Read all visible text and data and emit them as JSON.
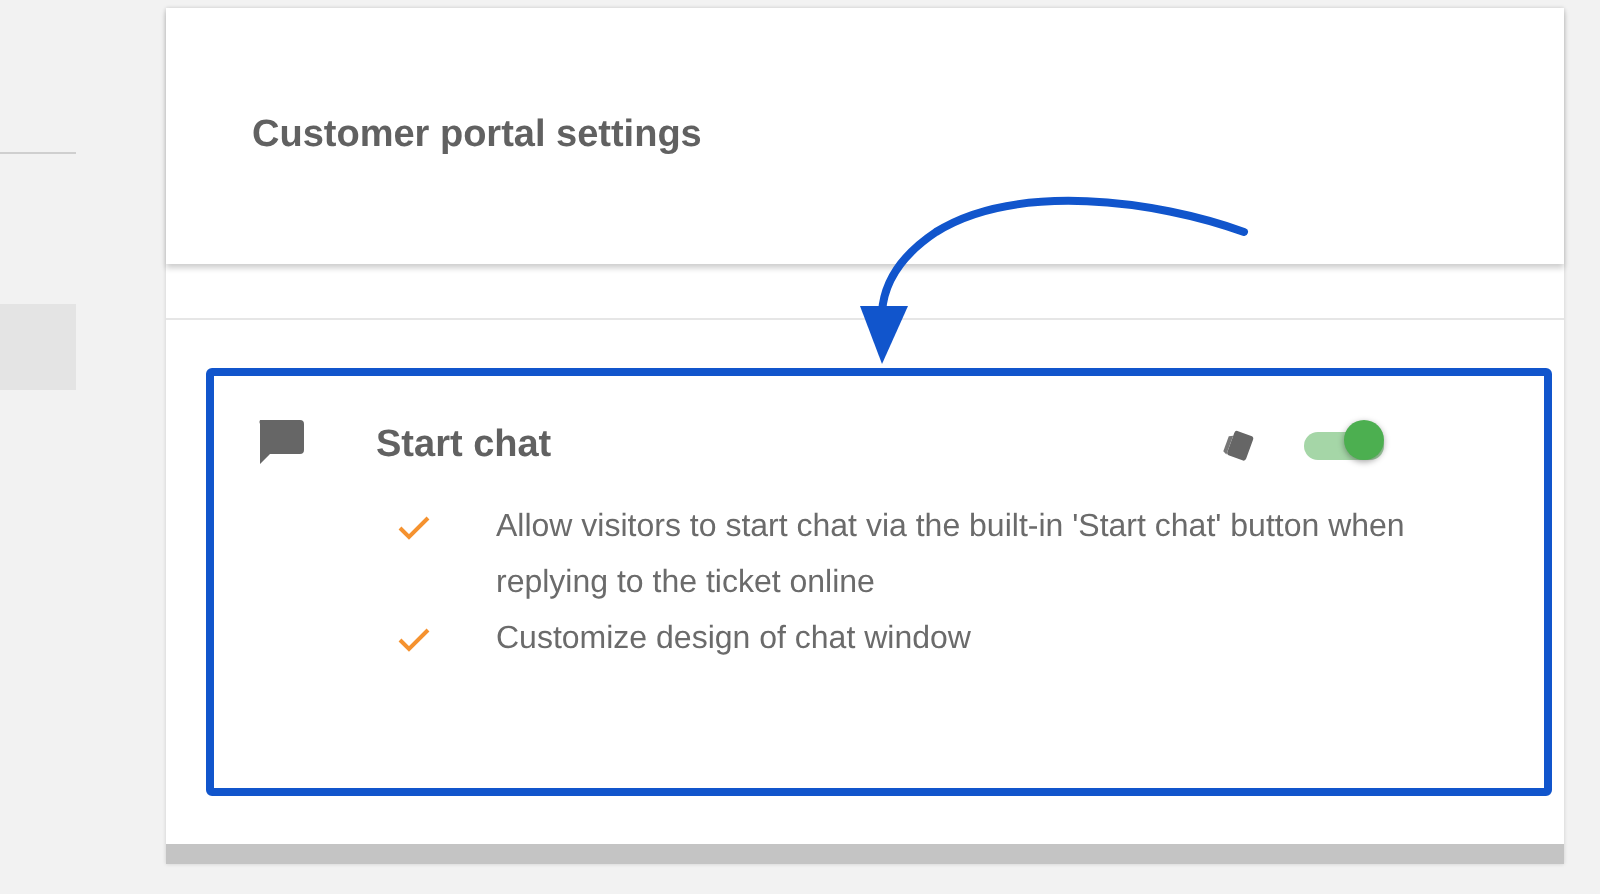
{
  "header": {
    "title": "Customer portal settings"
  },
  "feature": {
    "title": "Start chat",
    "enabled": true,
    "highlighted": true,
    "bullets": [
      "Allow visitors to start chat via the built-in 'Start chat' button when replying to the ticket online",
      "Customize design of chat window"
    ]
  }
}
